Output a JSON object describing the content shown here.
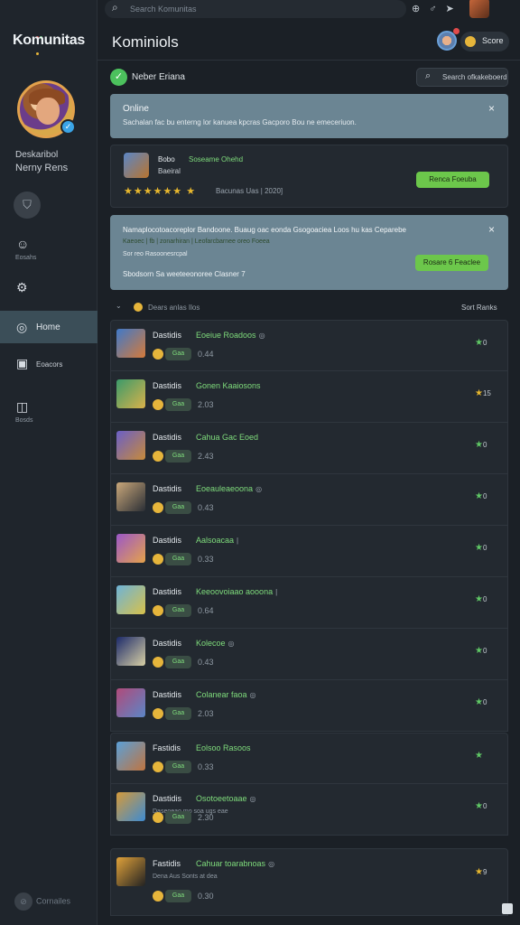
{
  "brand": {
    "name": "Komunitas"
  },
  "topbar": {
    "search_placeholder": "Search Komunitas"
  },
  "header": {
    "title": "Kominiols",
    "score_label": "Score"
  },
  "sidebar": {
    "user_line1": "Deskaribol",
    "user_line2": "Nerny Rens",
    "items": [
      {
        "label": "Eosahs"
      },
      {
        "label": ""
      },
      {
        "label": "Home"
      },
      {
        "label": "Eoacors"
      },
      {
        "label": "Bosds"
      }
    ],
    "footer_label": "Cornailes"
  },
  "status": {
    "label": "Neber Eriana",
    "filter_label": "Search ofkakeboerd"
  },
  "notice": {
    "title": "Online",
    "body": "Sachalan fac bu enterng lor kanuea kpcras Gacporo Bou ne emeceriuon.",
    "close": "×"
  },
  "featured": {
    "name": "Bobo",
    "game": "Soseame Ohehd",
    "sub": "Baeiral",
    "stars": "★★★★★★ ★",
    "rating": "Bacunas Uas | 2020]",
    "button": "Renca Foeuba"
  },
  "alert": {
    "title": "Namaplocotoacoreplor Bandoone. Buaug oac eonda Gsogoaciea Loos hu kas Ceparebe",
    "line2": "Kaeoec | fb | zonarhiran | Leofarcbarnee oreo Foeea",
    "line3": "Sor reo Rasoonesrcpal",
    "line4": "Sbodsorn Sa weeteeonoree Clasner 7",
    "button": "Rosare 6 Feaclee",
    "close": "×"
  },
  "list": {
    "header_label": "Dears anlas Ilos",
    "sort_label": "Sort Ranks",
    "rows": [
      {
        "user": "Dastidis",
        "game": "Eoeiue Roadoos",
        "mark": "◎",
        "tag": "Gaa",
        "time": "0.44",
        "score": "0"
      },
      {
        "user": "Dastidis",
        "game": "Gonen Kaaiosons",
        "mark": "",
        "tag": "Gaa",
        "time": "2.03",
        "score": "15"
      },
      {
        "user": "Dastidis",
        "game": "Cahua Gac Eoed",
        "mark": "",
        "tag": "Gaa",
        "time": "2.43",
        "score": "0"
      },
      {
        "user": "Dastidis",
        "game": "Eoeauleaeoona",
        "mark": "◎",
        "tag": "Gaa",
        "time": "0.43",
        "score": "0"
      },
      {
        "user": "Dastidis",
        "game": "Aalsoacaa",
        "mark": "|",
        "tag": "Gaa",
        "time": "0.33",
        "score": "0"
      },
      {
        "user": "Dastidis",
        "game": "Keeoovoiaao aooona",
        "mark": "|",
        "tag": "Gaa",
        "time": "0.64",
        "score": "0"
      },
      {
        "user": "Dastidis",
        "game": "Kolecoe",
        "mark": "◎",
        "tag": "Gaa",
        "time": "0.43",
        "score": "0"
      },
      {
        "user": "Dastidis",
        "game": "Colanear faoa",
        "mark": "◎",
        "tag": "Gaa",
        "time": "2.03",
        "score": "0"
      }
    ],
    "group2": [
      {
        "user": "Fastidis",
        "game": "Eolsoo Rasoos",
        "mark": "",
        "tag": "Gaa",
        "time": "0.33",
        "score": ""
      },
      {
        "user": "Dastidis",
        "game": "Osotoeetoaae",
        "mark": "◎",
        "tag": "Gaa",
        "time": "2.30",
        "extra": "Daseoeao mo soa ugs eae",
        "score": "0"
      }
    ],
    "group3": [
      {
        "user": "Fastidis",
        "game": "Cahuar toarabnoas",
        "mark": "◎",
        "tag": "Gaa",
        "time": "0.30",
        "extra": "Dena Aus Sonts at dea",
        "score": "9"
      }
    ]
  },
  "colors": {
    "accent_green": "#6cc74b",
    "banner": "#6b8593",
    "gold": "#e7b72e"
  }
}
